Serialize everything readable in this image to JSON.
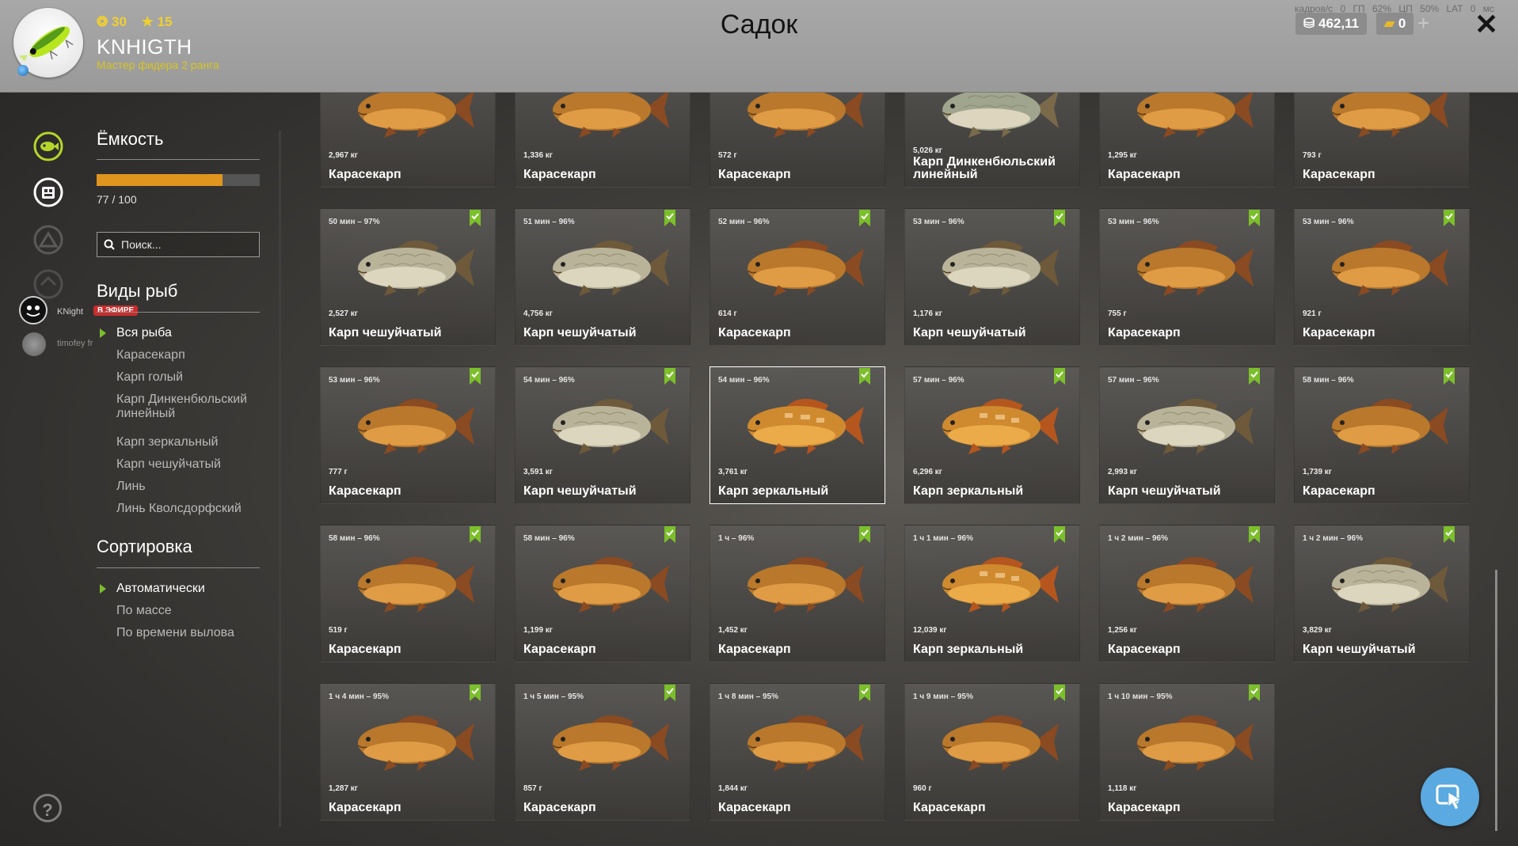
{
  "header": {
    "title": "Садок",
    "player": {
      "name": "KNHIGTH",
      "rank": "Мастер фидера 2 ранга",
      "coins": "30",
      "stars": "15"
    },
    "perf": "кадров/с 0  ГП 62%  ЦП 50%  LAT 0 мс",
    "money": "462,11",
    "gold": "0"
  },
  "stream": {
    "user1": "KNight",
    "live": "В ЭФИРЕ",
    "user2": "timofey fr"
  },
  "capacity": {
    "title": "Ёмкость",
    "current": 77,
    "max": 100,
    "label": "77 / 100",
    "search_placeholder": "Поиск..."
  },
  "species": {
    "title": "Виды рыб",
    "items": [
      "Вся рыба",
      "Карасекарп",
      "Карп голый",
      "Карп Динкенбюльский линейный",
      "Карп зеркальный",
      "Карп чешуйчатый",
      "Линь",
      "Линь Кволсдорфский"
    ],
    "active": 0
  },
  "sorting": {
    "title": "Сортировка",
    "items": [
      "Автоматически",
      "По массе",
      "По времени вылова"
    ],
    "active": 0
  },
  "colors": {
    "accent": "#e0951f",
    "green": "#7bbf2a",
    "live": "#cc2b2b",
    "fab": "#5aa9e0"
  },
  "fish": [
    {
      "time": "",
      "weight": "2,967 кг",
      "name": "Карасекарп",
      "kind": "golden",
      "bookmark": false
    },
    {
      "time": "",
      "weight": "1,336 кг",
      "name": "Карасекарп",
      "kind": "golden",
      "bookmark": false
    },
    {
      "time": "",
      "weight": "572 г",
      "name": "Карасекарп",
      "kind": "golden",
      "bookmark": false
    },
    {
      "time": "",
      "weight": "5,026 кг",
      "name": "Карп Динкенбюльский линейный",
      "kind": "linear",
      "bookmark": false
    },
    {
      "time": "",
      "weight": "1,295 кг",
      "name": "Карасекарп",
      "kind": "golden",
      "bookmark": false
    },
    {
      "time": "",
      "weight": "793 г",
      "name": "Карасекарп",
      "kind": "golden",
      "bookmark": false
    },
    {
      "time": "50 мин – 97%",
      "weight": "2,527 кг",
      "name": "Карп чешуйчатый",
      "kind": "scaled",
      "bookmark": true
    },
    {
      "time": "51 мин – 96%",
      "weight": "4,756 кг",
      "name": "Карп чешуйчатый",
      "kind": "scaled",
      "bookmark": true
    },
    {
      "time": "52 мин – 96%",
      "weight": "614 г",
      "name": "Карасекарп",
      "kind": "golden",
      "bookmark": true
    },
    {
      "time": "53 мин – 96%",
      "weight": "1,176 кг",
      "name": "Карп чешуйчатый",
      "kind": "scaled",
      "bookmark": true
    },
    {
      "time": "53 мин – 96%",
      "weight": "755 г",
      "name": "Карасекарп",
      "kind": "golden",
      "bookmark": true
    },
    {
      "time": "53 мин – 96%",
      "weight": "921 г",
      "name": "Карасекарп",
      "kind": "golden",
      "bookmark": true
    },
    {
      "time": "53 мин – 96%",
      "weight": "777 г",
      "name": "Карасекарп",
      "kind": "golden",
      "bookmark": true
    },
    {
      "time": "54 мин – 96%",
      "weight": "3,591 кг",
      "name": "Карп чешуйчатый",
      "kind": "scaled",
      "bookmark": true
    },
    {
      "time": "54 мин – 96%",
      "weight": "3,761 кг",
      "name": "Карп зеркальный",
      "kind": "mirror",
      "bookmark": true,
      "selected": true
    },
    {
      "time": "57 мин – 96%",
      "weight": "6,296 кг",
      "name": "Карп зеркальный",
      "kind": "mirror",
      "bookmark": true
    },
    {
      "time": "57 мин – 96%",
      "weight": "2,993 кг",
      "name": "Карп чешуйчатый",
      "kind": "scaled",
      "bookmark": true
    },
    {
      "time": "58 мин – 96%",
      "weight": "1,739 кг",
      "name": "Карасекарп",
      "kind": "golden",
      "bookmark": true
    },
    {
      "time": "58 мин – 96%",
      "weight": "519 г",
      "name": "Карасекарп",
      "kind": "golden",
      "bookmark": true
    },
    {
      "time": "58 мин – 96%",
      "weight": "1,199 кг",
      "name": "Карасекарп",
      "kind": "golden",
      "bookmark": true
    },
    {
      "time": "1 ч – 96%",
      "weight": "1,452 кг",
      "name": "Карасекарп",
      "kind": "golden",
      "bookmark": true
    },
    {
      "time": "1 ч 1 мин – 96%",
      "weight": "12,039 кг",
      "name": "Карп зеркальный",
      "kind": "mirror",
      "bookmark": true
    },
    {
      "time": "1 ч 2 мин – 96%",
      "weight": "1,256 кг",
      "name": "Карасекарп",
      "kind": "golden",
      "bookmark": true
    },
    {
      "time": "1 ч 2 мин – 96%",
      "weight": "3,829 кг",
      "name": "Карп чешуйчатый",
      "kind": "scaled",
      "bookmark": true
    },
    {
      "time": "1 ч 4 мин – 95%",
      "weight": "1,287 кг",
      "name": "Карасекарп",
      "kind": "golden",
      "bookmark": true
    },
    {
      "time": "1 ч 5 мин – 95%",
      "weight": "857 г",
      "name": "Карасекарп",
      "kind": "golden",
      "bookmark": true
    },
    {
      "time": "1 ч 8 мин – 95%",
      "weight": "1,844 кг",
      "name": "Карасекарп",
      "kind": "golden",
      "bookmark": true
    },
    {
      "time": "1 ч 9 мин – 95%",
      "weight": "960 г",
      "name": "Карасекарп",
      "kind": "golden",
      "bookmark": true
    },
    {
      "time": "1 ч 10 мин – 95%",
      "weight": "1,118 кг",
      "name": "Карасекарп",
      "kind": "golden",
      "bookmark": true
    }
  ]
}
